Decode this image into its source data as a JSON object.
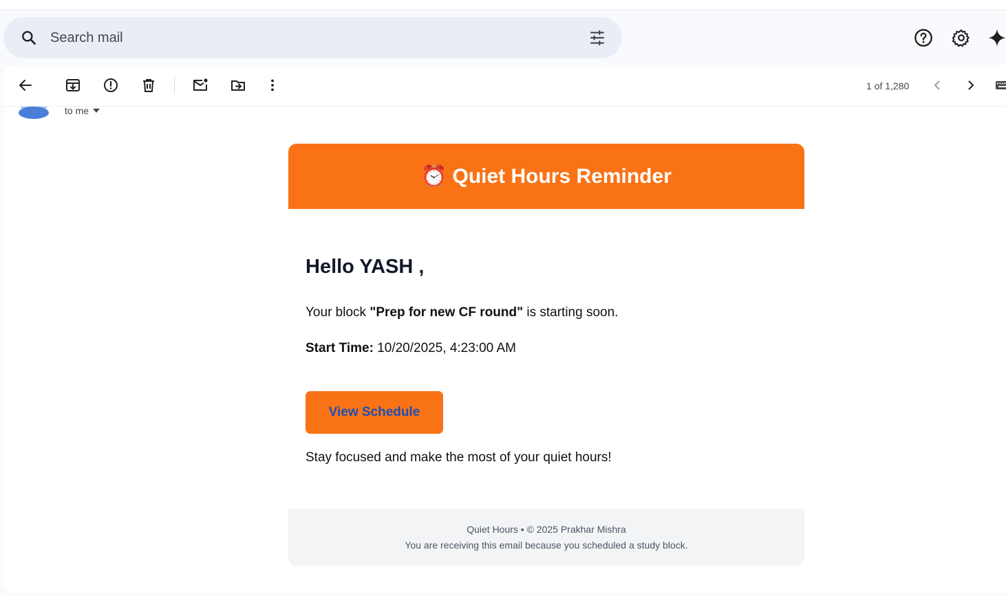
{
  "search": {
    "placeholder": "Search mail"
  },
  "header_icons": [
    "help-icon",
    "settings-icon",
    "gemini-icon"
  ],
  "toolbar": {
    "icons": [
      "back-arrow-icon",
      "archive-icon",
      "report-spam-icon",
      "delete-icon",
      "mark-unread-icon",
      "move-to-icon",
      "more-vert-icon"
    ],
    "counter": "1 of 1,280"
  },
  "recipient": {
    "label": "to me"
  },
  "email": {
    "banner_icon": "⏰",
    "banner_title": "Quiet Hours Reminder",
    "greeting": "Hello YASH ,",
    "block_prefix": "Your block ",
    "block_name": "\"Prep for new CF round\"",
    "block_suffix": " is starting soon.",
    "start_label": "Start Time:",
    "start_value": " 10/20/2025, 4:23:00 AM",
    "button_label": "View Schedule",
    "closing": "Stay focused and make the most of your quiet hours!",
    "footer_line1": "Quiet Hours • © 2025 Prakhar Mishra",
    "footer_line2": "You are receiving this email because you scheduled a study block."
  },
  "colors": {
    "accent": "#f97316",
    "button_text": "#1e4fb5",
    "footer_bg": "#f3f4f6"
  }
}
